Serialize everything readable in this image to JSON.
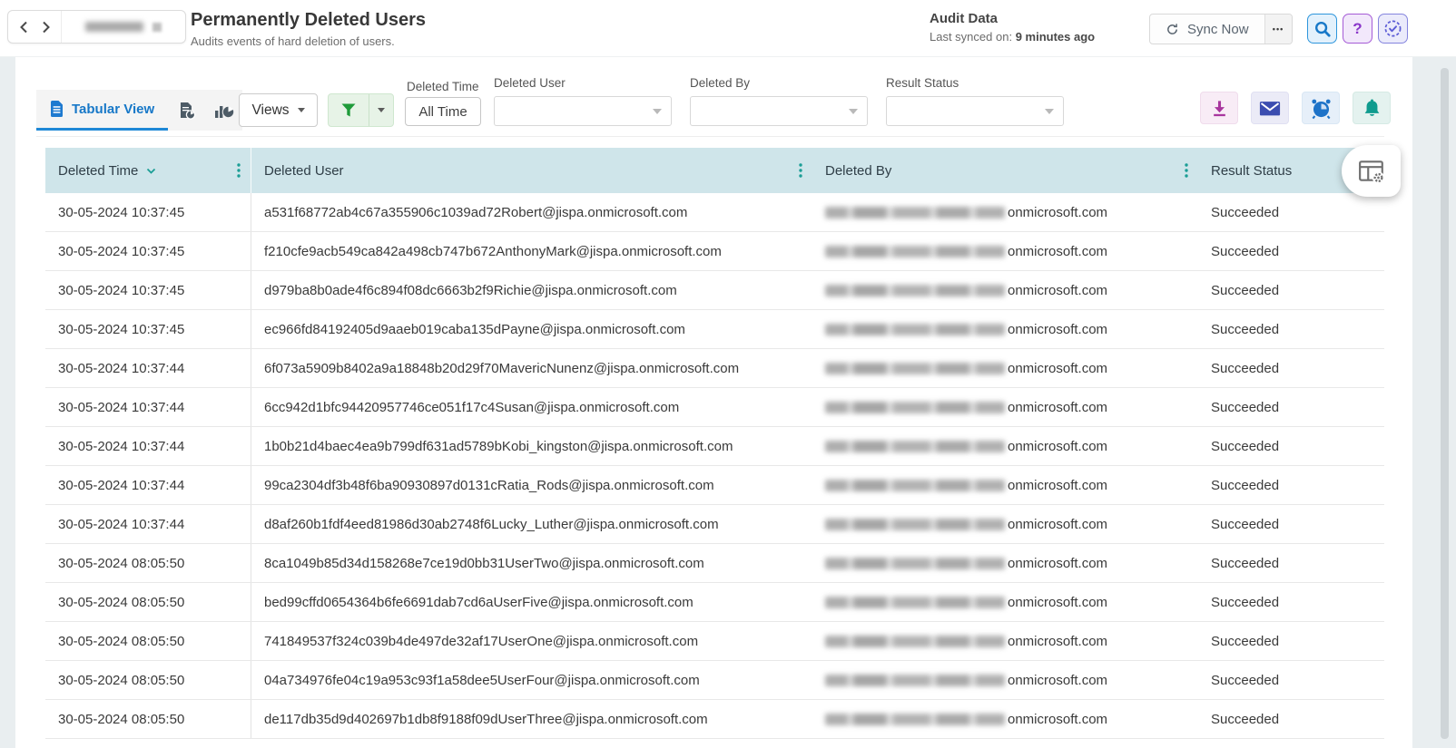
{
  "topbar": {
    "title": "Permanently Deleted Users",
    "subtitle": "Audits events of hard deletion of users.",
    "audit_panel": {
      "title": "Audit Data",
      "last_synced_label": "Last synced on:",
      "last_synced_value": "9 minutes ago"
    },
    "sync_button_label": "Sync Now",
    "more_button_glyph": "•••",
    "help_glyph": "?"
  },
  "toolbar": {
    "active_tab": "Tabular View",
    "views_button_label": "Views",
    "filters": {
      "deleted_time": {
        "label": "Deleted Time",
        "value": "All Time"
      },
      "deleted_user": {
        "label": "Deleted User",
        "value": ""
      },
      "deleted_by": {
        "label": "Deleted By",
        "value": ""
      },
      "result_status": {
        "label": "Result Status",
        "value": ""
      }
    }
  },
  "table": {
    "columns": [
      "Deleted Time",
      "Deleted User",
      "Deleted By",
      "Result Status"
    ],
    "sorted_column": "Deleted Time",
    "sort_direction": "desc",
    "deleted_by_redacted": true,
    "rows": [
      {
        "deleted_time": "30-05-2024 10:37:45",
        "deleted_user": "a531f68772ab4c67a355906c1039ad72Robert@jispa.onmicrosoft.com",
        "deleted_by_visible": "onmicrosoft.com",
        "result_status": "Succeeded"
      },
      {
        "deleted_time": "30-05-2024 10:37:45",
        "deleted_user": "f210cfe9acb549ca842a498cb747b672AnthonyMark@jispa.onmicrosoft.com",
        "deleted_by_visible": "onmicrosoft.com",
        "result_status": "Succeeded"
      },
      {
        "deleted_time": "30-05-2024 10:37:45",
        "deleted_user": "d979ba8b0ade4f6c894f08dc6663b2f9Richie@jispa.onmicrosoft.com",
        "deleted_by_visible": "onmicrosoft.com",
        "result_status": "Succeeded"
      },
      {
        "deleted_time": "30-05-2024 10:37:45",
        "deleted_user": "ec966fd84192405d9aaeb019caba135dPayne@jispa.onmicrosoft.com",
        "deleted_by_visible": "onmicrosoft.com",
        "result_status": "Succeeded"
      },
      {
        "deleted_time": "30-05-2024 10:37:44",
        "deleted_user": "6f073a5909b8402a9a18848b20d29f70MavericNunenz@jispa.onmicrosoft.com",
        "deleted_by_visible": "onmicrosoft.com",
        "result_status": "Succeeded"
      },
      {
        "deleted_time": "30-05-2024 10:37:44",
        "deleted_user": "6cc942d1bfc94420957746ce051f17c4Susan@jispa.onmicrosoft.com",
        "deleted_by_visible": "onmicrosoft.com",
        "result_status": "Succeeded"
      },
      {
        "deleted_time": "30-05-2024 10:37:44",
        "deleted_user": "1b0b21d4baec4ea9b799df631ad5789bKobi_kingston@jispa.onmicrosoft.com",
        "deleted_by_visible": "onmicrosoft.com",
        "result_status": "Succeeded"
      },
      {
        "deleted_time": "30-05-2024 10:37:44",
        "deleted_user": "99ca2304df3b48f6ba90930897d0131cRatia_Rods@jispa.onmicrosoft.com",
        "deleted_by_visible": "onmicrosoft.com",
        "result_status": "Succeeded"
      },
      {
        "deleted_time": "30-05-2024 10:37:44",
        "deleted_user": "d8af260b1fdf4eed81986d30ab2748f6Lucky_Luther@jispa.onmicrosoft.com",
        "deleted_by_visible": "onmicrosoft.com",
        "result_status": "Succeeded"
      },
      {
        "deleted_time": "30-05-2024 08:05:50",
        "deleted_user": "8ca1049b85d34d158268e7ce19d0bb31UserTwo@jispa.onmicrosoft.com",
        "deleted_by_visible": "onmicrosoft.com",
        "result_status": "Succeeded"
      },
      {
        "deleted_time": "30-05-2024 08:05:50",
        "deleted_user": "bed99cffd0654364b6fe6691dab7cd6aUserFive@jispa.onmicrosoft.com",
        "deleted_by_visible": "onmicrosoft.com",
        "result_status": "Succeeded"
      },
      {
        "deleted_time": "30-05-2024 08:05:50",
        "deleted_user": "741849537f324c039b4de497de32af17UserOne@jispa.onmicrosoft.com",
        "deleted_by_visible": "onmicrosoft.com",
        "result_status": "Succeeded"
      },
      {
        "deleted_time": "30-05-2024 08:05:50",
        "deleted_user": "04a734976fe04c19a953c93f1a58dee5UserFour@jispa.onmicrosoft.com",
        "deleted_by_visible": "onmicrosoft.com",
        "result_status": "Succeeded"
      },
      {
        "deleted_time": "30-05-2024 08:05:50",
        "deleted_user": "de117db35d9d402697b1db8f9188f09dUserThree@jispa.onmicrosoft.com",
        "deleted_by_visible": "onmicrosoft.com",
        "result_status": "Succeeded"
      }
    ]
  },
  "icons": {
    "back": "chevron-left",
    "forward": "chevron-right",
    "tenant_selector": "blurred-dropdown",
    "sync": "refresh-arrows",
    "more": "ellipsis",
    "search": "magnifier",
    "help": "question-mark",
    "scheduled_tasks": "dashed-clock-check",
    "tabular_view": "document",
    "export_report": "document-pie",
    "graphical_view": "bar-chart-pie",
    "filter": "green-funnel",
    "download": "download-arrow",
    "email": "envelope",
    "schedule_report": "alarm-clock",
    "notification": "bell",
    "column_chooser": "table-gear",
    "column_menu": "vertical-dots",
    "sort": "chevron-down"
  },
  "colors": {
    "page_bg": "#e9eef0",
    "accent_blue": "#1778c8",
    "tab_underline": "#1e88d6",
    "table_header_bg": "#cfe5ea",
    "table_header_text": "#2f3e47",
    "teal_accent": "#1b9e96",
    "filter_green": "#1f9b3a",
    "download_magenta": "#a8369e",
    "mail_indigo": "#3b4db0",
    "alarm_blue": "#1e73c8",
    "bell_teal": "#0f9b8e",
    "help_purple": "#8a35c9",
    "tasks_indigo": "#5c5cd6",
    "row_border": "#e8e8e8",
    "body_text": "#3a3a3a"
  }
}
